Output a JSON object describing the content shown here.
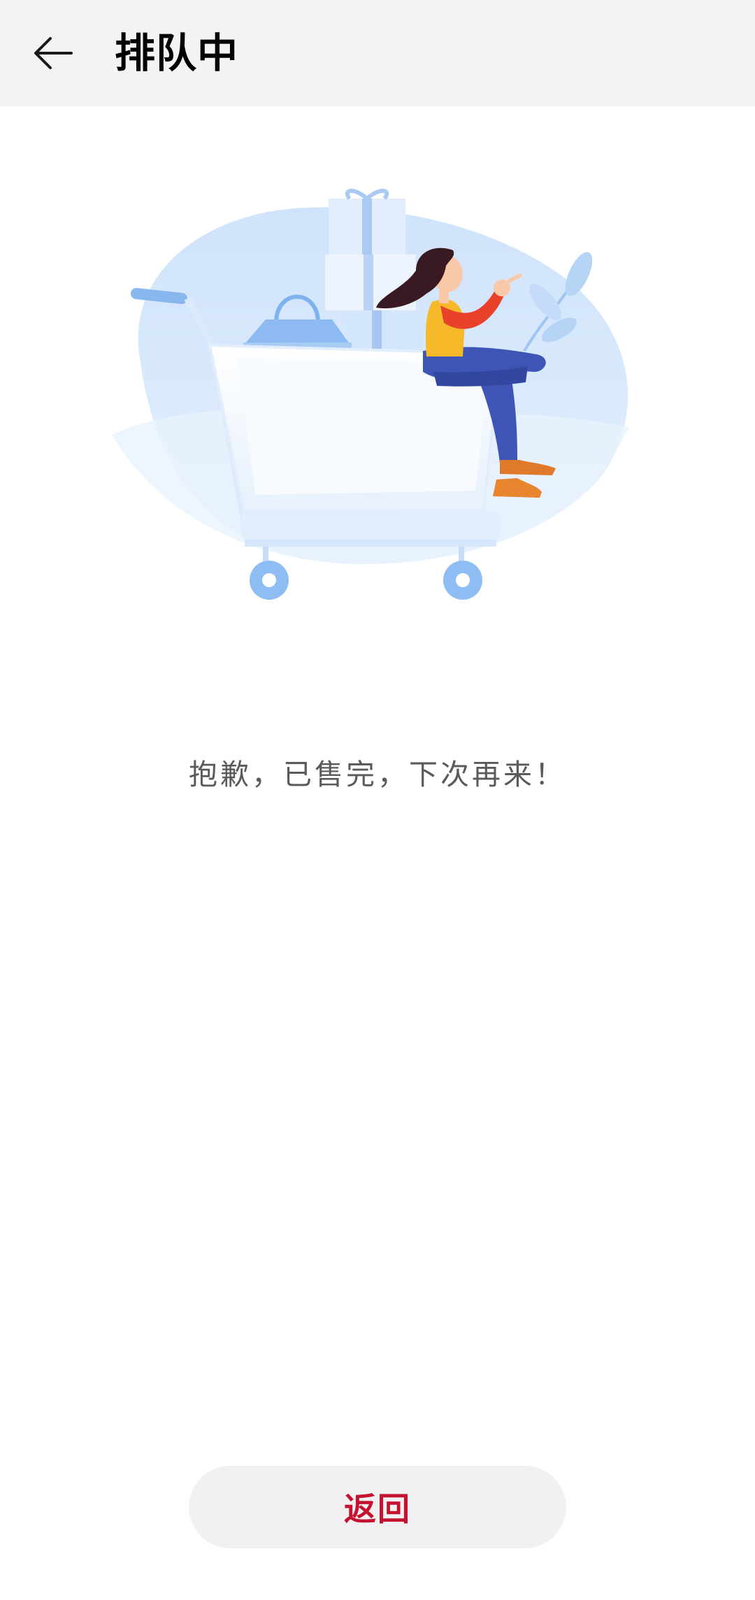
{
  "header": {
    "title": "排队中",
    "back_icon": "arrow-left-icon"
  },
  "illustration": {
    "name": "woman-on-shopping-cart-illustration",
    "colors": {
      "blob": "#d6e8fc",
      "cart": "#eef5fd",
      "accent_blue": "#7fb2ef",
      "shirt_yellow": "#f5b92a",
      "sleeve_red": "#e8432a",
      "pants_blue": "#3f55b5",
      "shoes_orange": "#e07a2b",
      "hair": "#3a1a22"
    }
  },
  "message": "抱歉，已售完，下次再来！",
  "footer": {
    "return_label": "返回"
  },
  "colors": {
    "header_bg": "#f1f3f5",
    "accent_red": "#c41230",
    "message_gray": "#5a5a5a",
    "button_bg": "#f1f1f1"
  }
}
